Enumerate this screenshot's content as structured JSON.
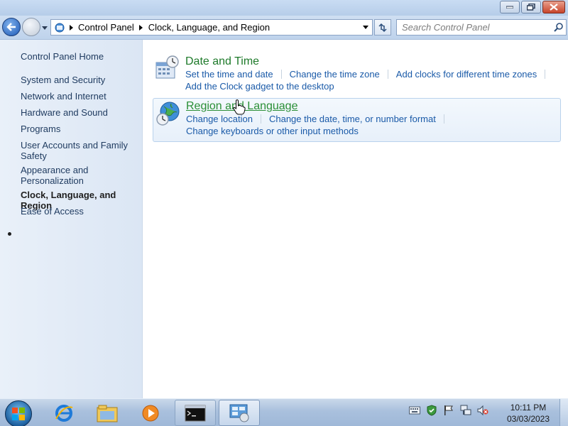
{
  "window": {
    "minimize_icon": "minimize-icon",
    "maximize_icon": "maximize-icon",
    "close_icon": "close-icon"
  },
  "navigation": {
    "breadcrumbs": [
      "Control Panel",
      "Clock, Language, and Region"
    ],
    "search_placeholder": "Search Control Panel"
  },
  "sidebar": {
    "home": "Control Panel Home",
    "items": [
      "System and Security",
      "Network and Internet",
      "Hardware and Sound",
      "Programs",
      "User Accounts and Family Safety",
      "Appearance and Personalization",
      "Clock, Language, and Region",
      "Ease of Access"
    ],
    "active_item": "Clock, Language, and Region"
  },
  "categories": [
    {
      "title": "Date and Time",
      "icon": "date-time-icon",
      "tasks_row1": [
        "Set the time and date",
        "Change the time zone",
        "Add clocks for different time zones"
      ],
      "tasks_row2": [
        "Add the Clock gadget to the desktop"
      ]
    },
    {
      "title": "Region and Language",
      "icon": "globe-clock-icon",
      "tasks_row1": [
        "Change location",
        "Change the date, time, or number format"
      ],
      "tasks_row2": [
        "Change keyboards or other input methods"
      ]
    }
  ],
  "taskbar": {
    "pinned": [
      "windows-start-icon",
      "internet-explorer-icon",
      "windows-explorer-icon",
      "media-player-icon",
      "command-prompt-icon",
      "control-panel-icon"
    ],
    "tray_icons": [
      "keyboard-icon",
      "security-shield-icon",
      "action-center-flag-icon",
      "network-icon",
      "volume-muted-icon"
    ],
    "time": "10:11 PM",
    "date": "03/03/2023"
  },
  "colors": {
    "link": "#1a5aa8",
    "category_title": "#1e7a2a",
    "sidebar_link": "#1e3a5f"
  }
}
